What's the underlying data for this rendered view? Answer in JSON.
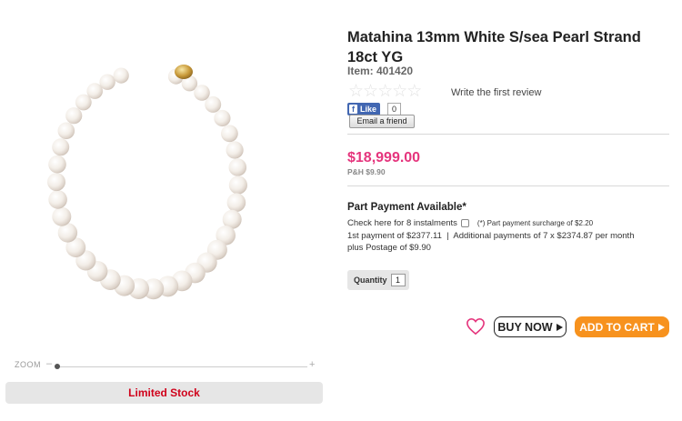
{
  "product": {
    "title": "Matahina 13mm White S/sea Pearl Strand 18ct YG",
    "item": "Item: 401420",
    "review_link": "Write the first review",
    "rating_stars": 0,
    "price": "$18,999.00",
    "postage": "P&H $9.90",
    "stock_status": "Limited Stock"
  },
  "social": {
    "like_label": "Like",
    "like_count": "0",
    "email_label": "Email a friend"
  },
  "image": {
    "zoom_label": "ZOOM",
    "zoom_minus": "–",
    "zoom_plus": "+"
  },
  "part_payment": {
    "title": "Part Payment Available*",
    "checkbox_label": "Check here for 8 instalments",
    "surcharge": "(*) Part payment surcharge of $2.20",
    "line2": "1st payment of $2377.11  |  Additional payments of 7 x $2374.87 per month",
    "line3": "plus Postage of $9.90"
  },
  "quantity": {
    "label": "Quantity",
    "value": "1"
  },
  "actions": {
    "buy_now": "BUY NOW",
    "add_to_cart": "ADD TO CART",
    "wishlist_icon": "heart-icon"
  },
  "colors": {
    "price": "#e5357d",
    "add_to_cart": "#f7921e",
    "stock": "#d0021b",
    "facebook": "#4267b2"
  }
}
